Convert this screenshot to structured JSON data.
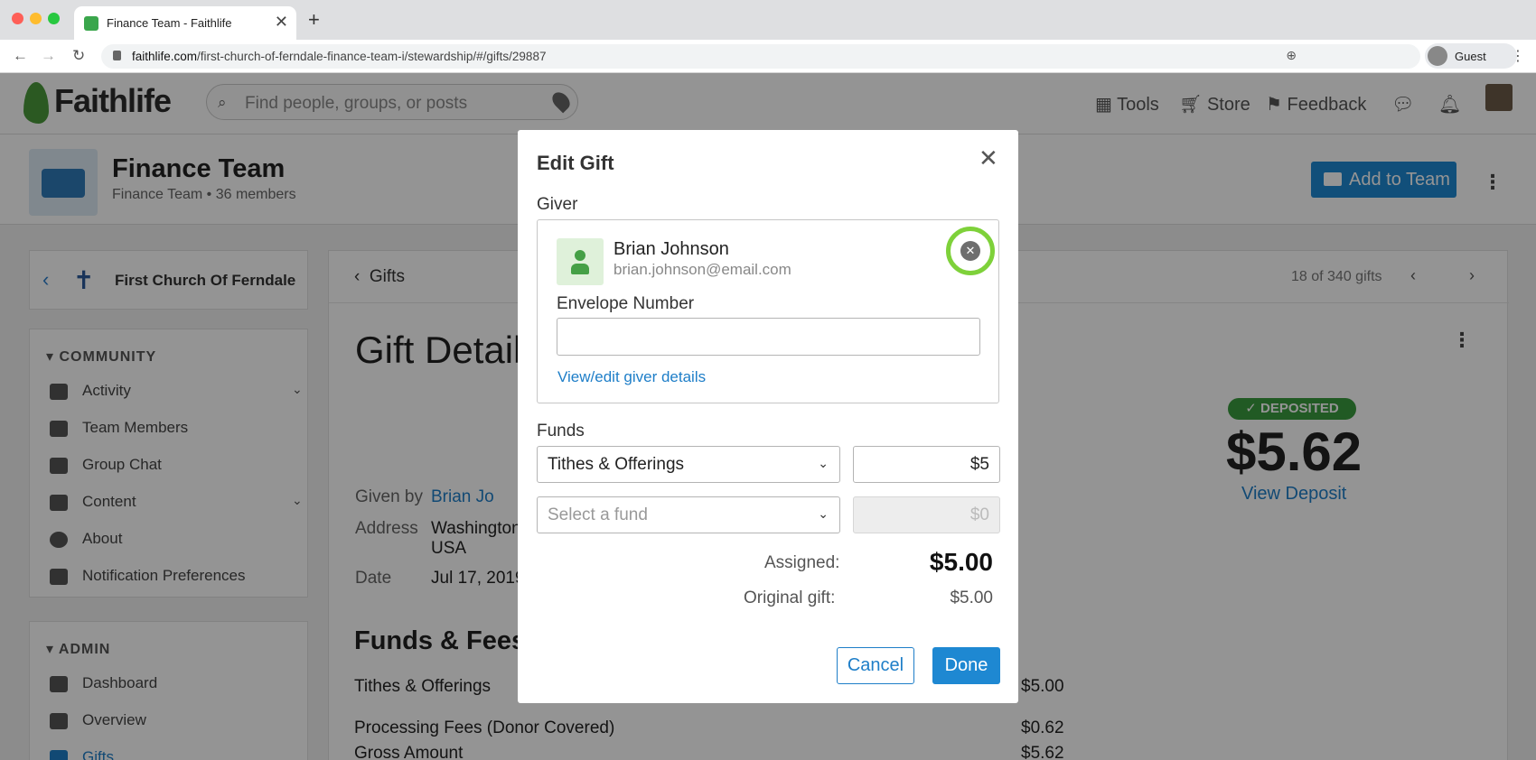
{
  "browser": {
    "tab_title": "Finance Team - Faithlife",
    "url_host": "faithlife.com",
    "url_path": "/first-church-of-ferndale-finance-team-i/stewardship/#/gifts/29887",
    "profile_label": "Guest",
    "new_tab_glyph": "+",
    "tab_close_glyph": "✕"
  },
  "header": {
    "logo_text": "Faithlife",
    "search_placeholder": "Find people, groups, or posts",
    "nav": {
      "tools": "Tools",
      "store": "Store",
      "feedback": "Feedback"
    }
  },
  "team": {
    "name": "Finance Team",
    "subtitle": "Finance Team  •  36 members",
    "add_button": "Add to Team"
  },
  "sidebar": {
    "church_name": "First Church Of Ferndale",
    "community_heading": "COMMUNITY",
    "community_items": [
      "Activity",
      "Team Members",
      "Group Chat",
      "Content",
      "About",
      "Notification Preferences"
    ],
    "admin_heading": "ADMIN",
    "admin_items": [
      "Dashboard",
      "Overview",
      "Gifts"
    ]
  },
  "gift": {
    "back_label": "Gifts",
    "count_label": "18 of 340 gifts",
    "title": "Gift Detail",
    "given_by_label": "Given by",
    "given_by_value": "Brian Jo",
    "address_label": "Address",
    "address_line1": "Washington",
    "address_line2": "USA",
    "date_label": "Date",
    "date_value": "Jul 17, 2019",
    "deposit_status": "✓  DEPOSITED",
    "deposit_amount": "$5.62",
    "view_deposit": "View Deposit",
    "funds_fees_title": "Funds & Fees",
    "funds_fees_rows": [
      {
        "label": "Tithes & Offerings",
        "value": "$5.00"
      },
      {
        "label": "Processing Fees (Donor Covered)",
        "value": "$0.62"
      },
      {
        "label": "Gross Amount",
        "value": "$5.62"
      }
    ]
  },
  "modal": {
    "title": "Edit Gift",
    "giver_label": "Giver",
    "giver_name": "Brian Johnson",
    "giver_email": "brian.johnson@email.com",
    "envelope_label": "Envelope Number",
    "envelope_value": "",
    "view_edit_link": "View/edit giver details",
    "funds_label": "Funds",
    "fund_rows": [
      {
        "fund": "Tithes & Offerings",
        "amount": "$5",
        "is_placeholder": false
      },
      {
        "fund": "Select a fund",
        "amount": "$0",
        "is_placeholder": true
      }
    ],
    "assigned_label": "Assigned:",
    "assigned_value": "$5.00",
    "original_label": "Original gift:",
    "original_value": "$5.00",
    "cancel_label": "Cancel",
    "done_label": "Done"
  },
  "colors": {
    "brand_green": "#4a9a3c",
    "primary_blue": "#1e88d2",
    "link_blue": "#1e7ec8",
    "highlight_ring": "#7ed13a",
    "deposited_green": "#3a9b3e"
  }
}
